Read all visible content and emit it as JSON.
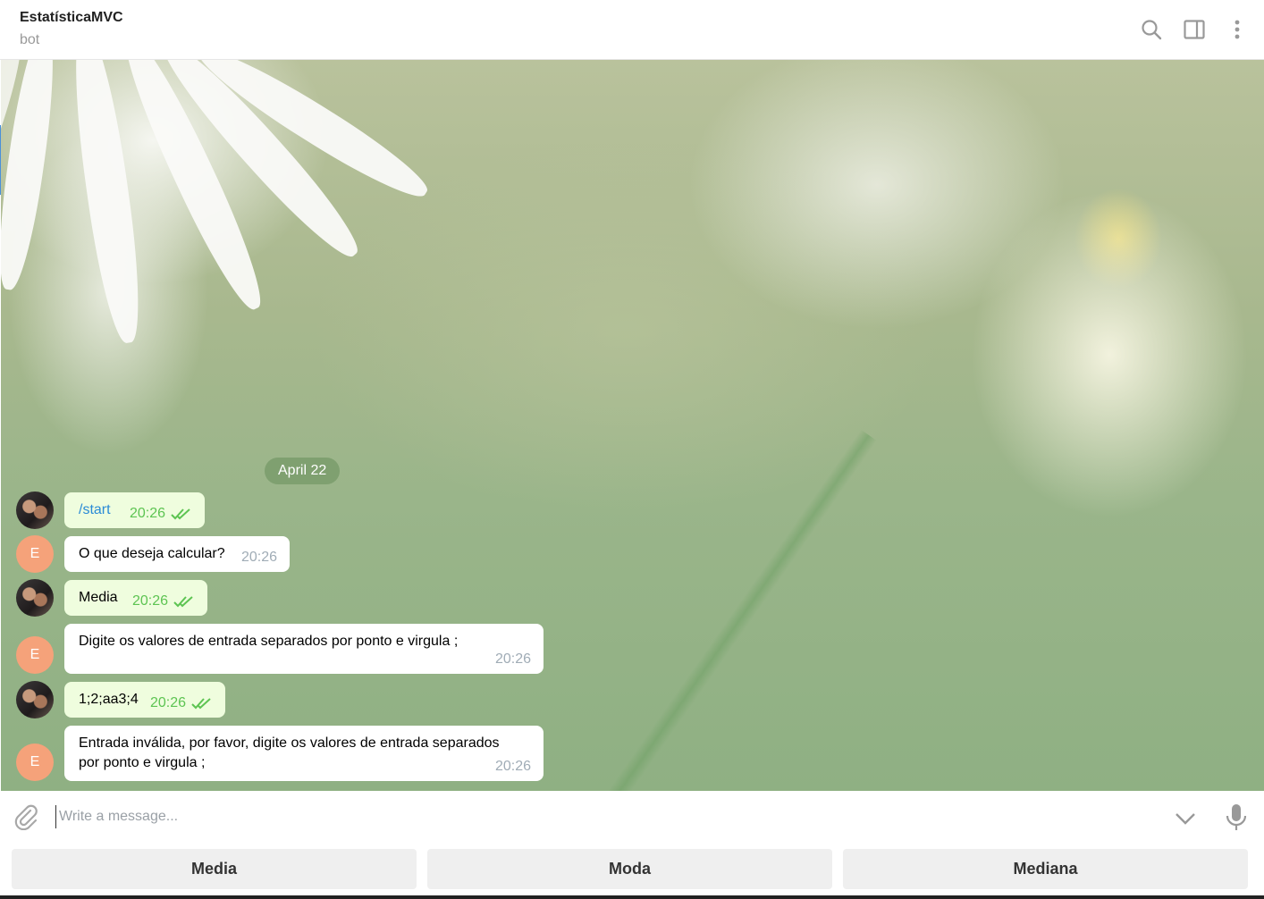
{
  "header": {
    "title": "EstatísticaMVC",
    "status": "bot",
    "icons": [
      "search-icon",
      "sidebar-toggle-icon",
      "more-vertical-icon"
    ]
  },
  "chat": {
    "date_label": "April 22",
    "messages": [
      {
        "direction": "outgoing",
        "avatar": "user-photo",
        "text": "/start",
        "time": "20:26",
        "read": true
      },
      {
        "direction": "incoming",
        "avatar_letter": "E",
        "text": "O que deseja calcular?",
        "time": "20:26"
      },
      {
        "direction": "outgoing",
        "avatar": "user-photo",
        "text": "Media",
        "time": "20:26",
        "read": true
      },
      {
        "direction": "incoming",
        "avatar_letter": "E",
        "text": "Digite os valores de entrada separados por ponto e virgula ;",
        "time": "20:26"
      },
      {
        "direction": "outgoing",
        "avatar": "user-photo",
        "text": "1;2;aa3;4",
        "time": "20:26",
        "read": true
      },
      {
        "direction": "incoming",
        "avatar_letter": "E",
        "text": "Entrada inválida, por favor, digite os valores de entrada separados\npor ponto e virgula ;",
        "time": "20:26"
      }
    ]
  },
  "composer": {
    "placeholder": "Write a message...",
    "value": ""
  },
  "keyboard": {
    "buttons": [
      "Media",
      "Moda",
      "Mediana"
    ]
  },
  "colors": {
    "outgoing_bubble": "#effdde",
    "incoming_bubble": "#ffffff",
    "read_ticks": "#5dc452",
    "command_link": "#2a8bd6",
    "bot_avatar": "#f5a27a",
    "date_pill": "#7fa070"
  }
}
